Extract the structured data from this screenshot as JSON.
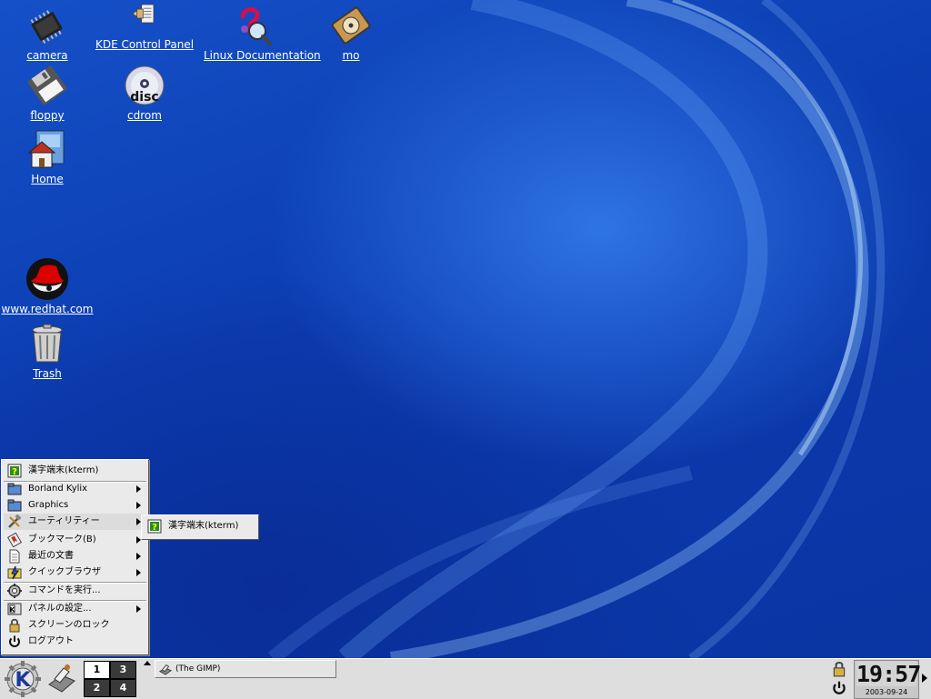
{
  "desktop": {
    "icons": [
      {
        "name": "camera",
        "label": "camera",
        "icon": "camera-chip-icon"
      },
      {
        "name": "kde-control-panel",
        "label": "KDE Control Panel",
        "icon": "control-panel-icon"
      },
      {
        "name": "linux-documentation",
        "label": "Linux Documentation",
        "icon": "help-magnifier-icon"
      },
      {
        "name": "mo",
        "label": "mo",
        "icon": "disk-drive-icon"
      },
      {
        "name": "floppy",
        "label": "floppy",
        "icon": "floppy-icon"
      },
      {
        "name": "cdrom",
        "label": "cdrom",
        "icon": "cd-disc-icon",
        "disc_text": "disc"
      },
      {
        "name": "home",
        "label": "Home",
        "icon": "home-folder-icon"
      },
      {
        "name": "redhat",
        "label": "www.redhat.com",
        "icon": "redhat-logo-icon"
      },
      {
        "name": "trash",
        "label": "Trash",
        "icon": "trash-can-icon"
      }
    ]
  },
  "start_menu": {
    "items": [
      {
        "label": "漢字端末(kterm)",
        "icon": "kterm-icon",
        "submenu": false
      },
      {
        "label": "Borland Kylix",
        "icon": "folder-icon",
        "submenu": true
      },
      {
        "label": "Graphics",
        "icon": "folder-icon",
        "submenu": true
      },
      {
        "label": "ユーティリティー",
        "icon": "tools-icon",
        "submenu": true,
        "highlighted": true
      },
      {
        "label": "ブックマーク(B)",
        "icon": "bookmark-icon",
        "submenu": true
      },
      {
        "label": "最近の文書",
        "icon": "document-icon",
        "submenu": true
      },
      {
        "label": "クイックブラウザ",
        "icon": "quick-browser-icon",
        "submenu": true
      },
      {
        "label": "コマンドを実行...",
        "icon": "run-command-icon",
        "submenu": false
      },
      {
        "label": "パネルの設定...",
        "icon": "panel-settings-icon",
        "submenu": true
      },
      {
        "label": "スクリーンのロック",
        "icon": "lock-icon",
        "submenu": false
      },
      {
        "label": "ログアウト",
        "icon": "logout-icon",
        "submenu": false
      }
    ]
  },
  "submenu": {
    "items": [
      {
        "label": "漢字端末(kterm)",
        "icon": "kterm-icon"
      }
    ]
  },
  "panel": {
    "pager": [
      "1",
      "3",
      "2",
      "4"
    ],
    "active_desktop": "1",
    "task": {
      "label": "(The GIMP)",
      "icon": "gimp-icon"
    },
    "clock": {
      "time": "19:57",
      "date": "2003-09-24"
    }
  },
  "colors": {
    "desktop": "#0b3cb0",
    "panel": "#dedede",
    "menu": "#eaeaea",
    "icon_label": "#ffffff"
  }
}
